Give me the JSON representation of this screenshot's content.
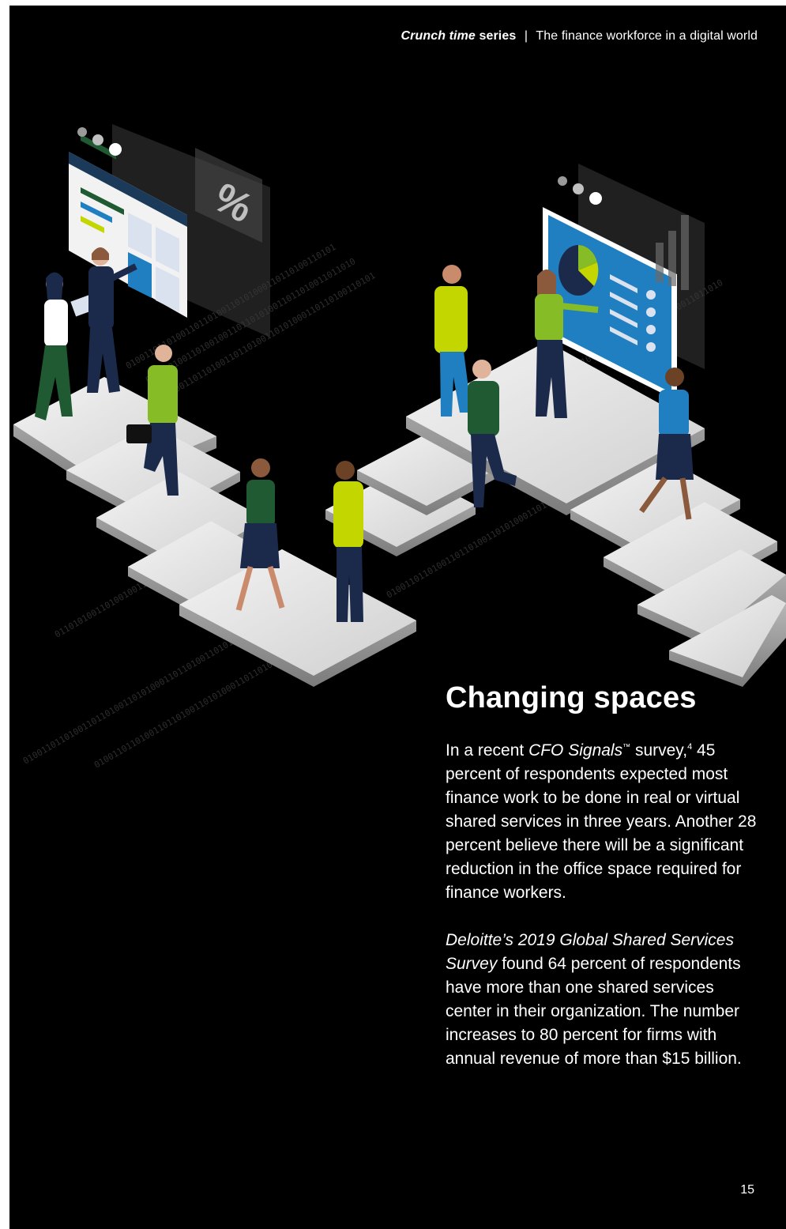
{
  "header": {
    "brand_italic": "Crunch time",
    "brand_rest": "series",
    "separator": "|",
    "subtitle": "The finance workforce in a digital world"
  },
  "illustration": {
    "binary_strings": [
      "0100110110100110110100110101000110110100110101",
      "0110101001101001001101101010011011010011011010",
      "0100110110100110110100110101000110110100110101",
      "0110101001101001001101101010011011010011011010",
      "0100110110100110110100110101000110110100110101"
    ],
    "percent_sign": "%",
    "colors": {
      "platform": "#e3e3e3",
      "platform_edge": "#9a9a9a",
      "lime": "#c4d600",
      "green": "#86bc25",
      "dark_green": "#1f5a33",
      "navy": "#1b2a4a",
      "blue": "#1f7fc1",
      "skin": "#c98b6b"
    }
  },
  "article": {
    "title": "Changing spaces",
    "paragraph1": {
      "prefix": "In a recent ",
      "publication": "CFO Signals",
      "trademark": "™",
      "middle": " survey,",
      "footnote": "4",
      "rest": " 45 percent of respondents expected most finance work to be done in real or virtual shared services in three years. Another 28 percent believe there will be a significant reduction in the office space required for finance workers."
    },
    "paragraph2": {
      "publication": "Deloitte’s 2019 Global Shared Services Survey",
      "rest": " found 64 percent of respondents have more than one shared services center in their organization. The number increases to 80 percent for firms with annual revenue of more than $15 billion."
    }
  },
  "page_number": "15"
}
